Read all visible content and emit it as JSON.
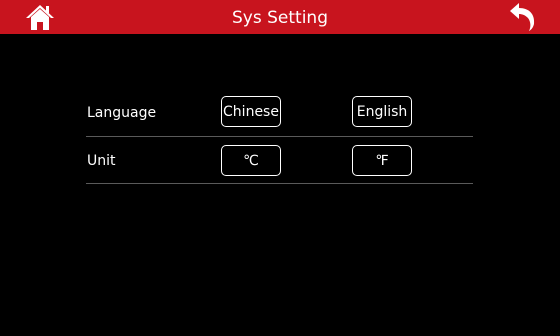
{
  "header": {
    "title": "Sys Setting",
    "home_icon": "home-icon",
    "back_icon": "back-arrow-icon",
    "bar_color": "#c8141e"
  },
  "settings": {
    "language": {
      "label": "Language",
      "options": [
        "Chinese",
        "English"
      ]
    },
    "unit": {
      "label": "Unit",
      "options": [
        "℃",
        "℉"
      ]
    }
  }
}
